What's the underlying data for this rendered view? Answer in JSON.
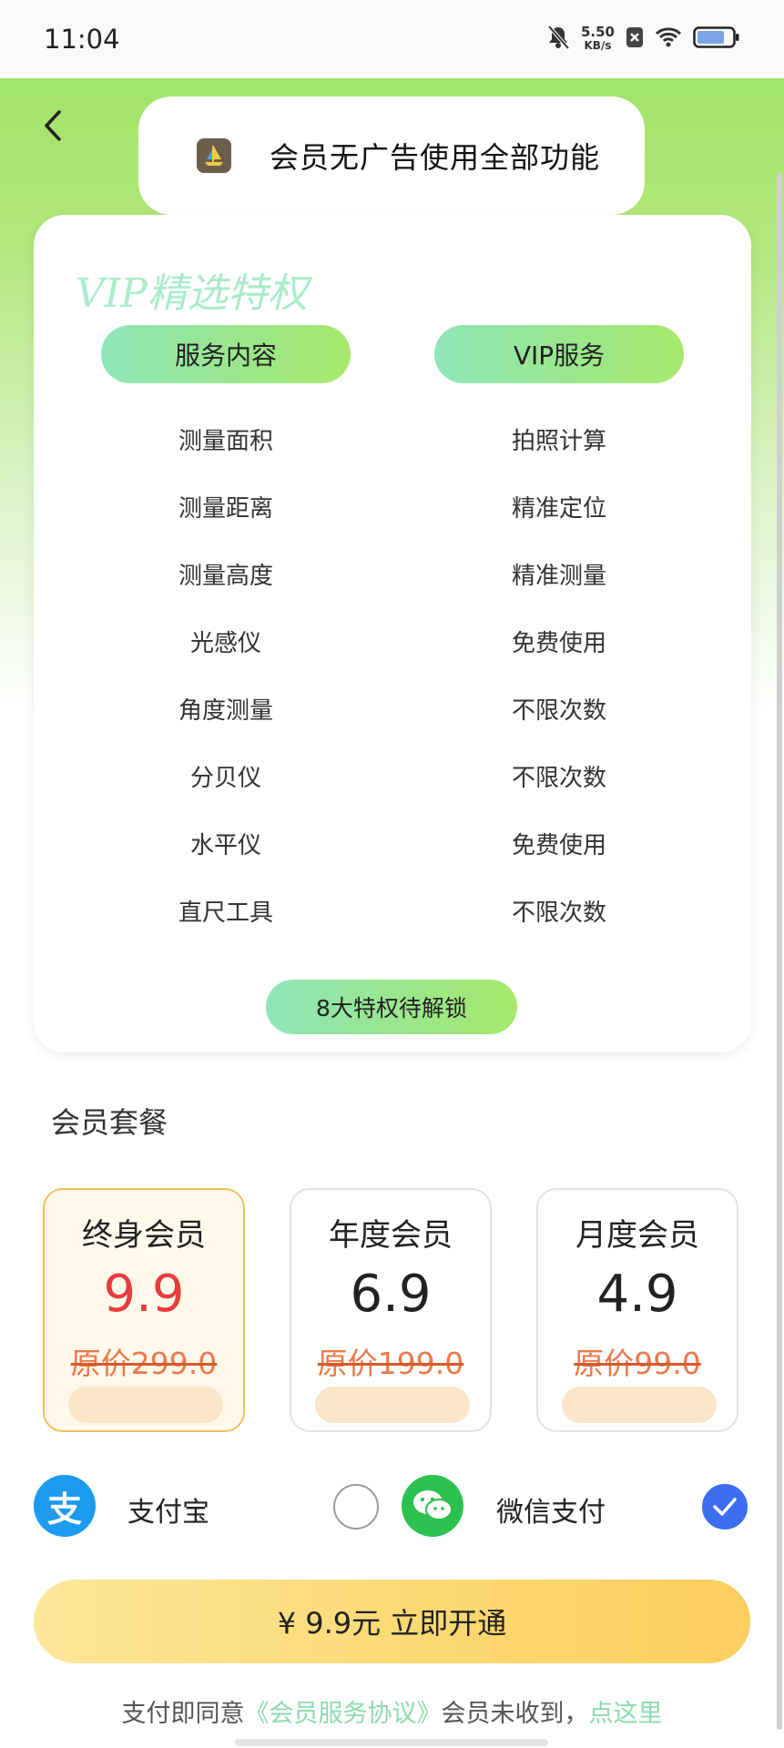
{
  "status_bar": {
    "time": "11:04",
    "net_speed_value": "5.50",
    "net_speed_unit": "KB/s"
  },
  "header": {
    "title": "会员无广告使用全部功能"
  },
  "vip_card": {
    "heading": "VIP精选特权",
    "col_left": "服务内容",
    "col_right": "VIP服务",
    "rows": [
      {
        "service": "测量面积",
        "vip": "拍照计算"
      },
      {
        "service": "测量距离",
        "vip": "精准定位"
      },
      {
        "service": "测量高度",
        "vip": "精准测量"
      },
      {
        "service": "光感仪",
        "vip": "免费使用"
      },
      {
        "service": "角度测量",
        "vip": "不限次数"
      },
      {
        "service": "分贝仪",
        "vip": "不限次数"
      },
      {
        "service": "水平仪",
        "vip": "免费使用"
      },
      {
        "service": "直尺工具",
        "vip": "不限次数"
      }
    ],
    "unlock_label": "8大特权待解锁"
  },
  "plans": {
    "section_title": "会员套餐",
    "items": [
      {
        "name": "终身会员",
        "price": "9.9",
        "original": "原价299.0",
        "selected": true
      },
      {
        "name": "年度会员",
        "price": "6.9",
        "original": "原价199.0",
        "selected": false
      },
      {
        "name": "月度会员",
        "price": "4.9",
        "original": "原价99.0",
        "selected": false
      }
    ]
  },
  "payment": {
    "alipay_label": "支付宝",
    "alipay_icon_char": "支",
    "wechat_label": "微信支付",
    "selected": "wechat"
  },
  "cta": {
    "label": "¥ 9.9元 立即开通"
  },
  "agreement": {
    "prefix": "支付即同意",
    "link": "《会员服务协议》",
    "middle": "会员未收到，",
    "here": "点这里"
  },
  "colors": {
    "accent_green": "#a6e86a",
    "price_red": "#e83d3d",
    "strike_orange": "#ea7a4b",
    "checked_blue": "#3c6df0"
  }
}
